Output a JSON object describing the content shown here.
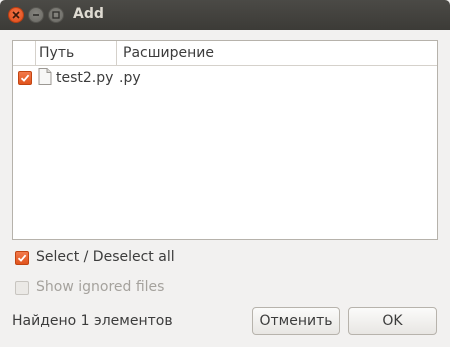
{
  "window": {
    "title": "Add",
    "controls": [
      "close-icon",
      "minimize-icon",
      "maximize-icon"
    ]
  },
  "table": {
    "columns": [
      "",
      "Путь",
      "Расширение"
    ],
    "rows": [
      {
        "checked": true,
        "path": "test2.py",
        "extension": ".py",
        "icon": "file-icon"
      }
    ]
  },
  "options": {
    "select_all_label": "Select / Deselect all",
    "select_all_checked": true,
    "show_ignored_label": "Show ignored files",
    "show_ignored_checked": false,
    "show_ignored_enabled": false
  },
  "status": {
    "found_text": "Найдено 1 элементов"
  },
  "buttons": {
    "cancel_label": "Отменить",
    "ok_label": "OK"
  },
  "colors": {
    "accent": "#e95420",
    "titlebar": "#3c3b37"
  }
}
